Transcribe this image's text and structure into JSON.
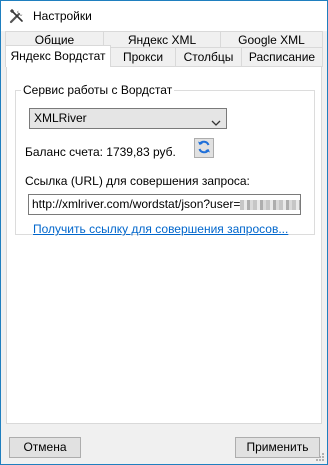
{
  "window": {
    "title": "Настройки",
    "icon": "tools-icon"
  },
  "tabs": {
    "row1": [
      "Общие",
      "Яндекс XML",
      "Google XML"
    ],
    "row2": [
      "Яндекс Вордстат",
      "Прокси",
      "Столбцы",
      "Расписание"
    ],
    "active": "Яндекс Вордстат"
  },
  "group": {
    "legend": "Сервис работы с Вордстат",
    "select_value": "XMLRiver",
    "select_icon": "chevron-down-icon",
    "balance_text": "Баланс счета: 1739,83 руб.",
    "refresh_icon": "refresh-icon",
    "url_label": "Ссылка (URL) для совершения запроса:",
    "url_value": "http://xmlriver.com/wordstat/json?user=",
    "link_text": "Получить ссылку для совершения запросов..."
  },
  "buttons": {
    "cancel": "Отмена",
    "apply": "Применить"
  },
  "colors": {
    "window_border": "#1f7fbf",
    "link": "#0066cc",
    "refresh_blue": "#1e6fd9"
  }
}
